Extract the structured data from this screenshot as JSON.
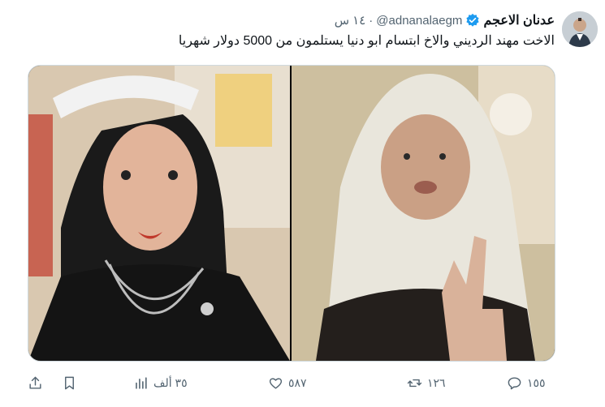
{
  "author": {
    "name": "عدنان الاعجم",
    "handle": "@adnanalaegm",
    "separator": "·",
    "time": "١٤ س"
  },
  "tweet": {
    "text": "الاخت مهند الرديني والاخ ابتسام ابو دنيا  يستلمون  من 5000 دولار شهريا"
  },
  "actions": {
    "reply_count": "١٥٥",
    "retweet_count": "١٢٦",
    "like_count": "٥٨٧",
    "views_count": "٣٥ ألف"
  },
  "colors": {
    "verified": "#1d9bf0",
    "muted": "#536471"
  }
}
